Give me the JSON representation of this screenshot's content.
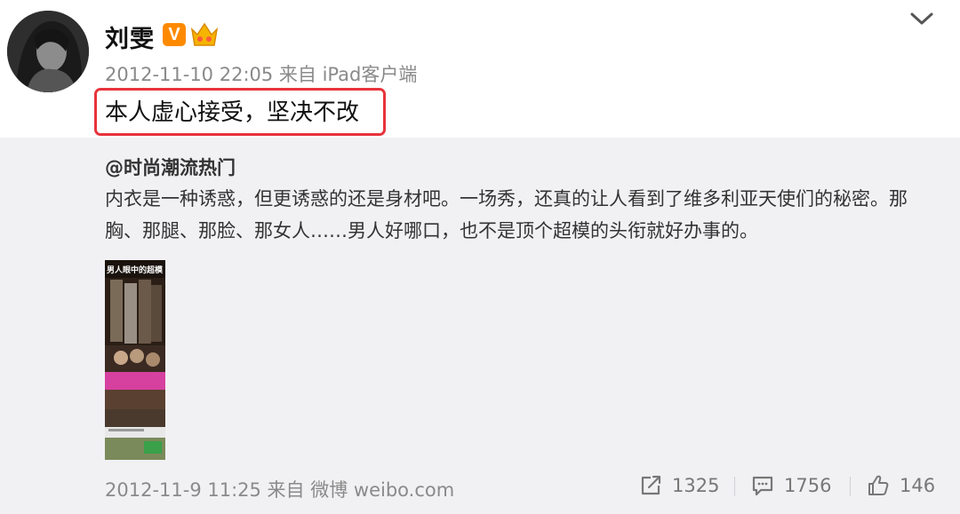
{
  "post": {
    "author": "刘雯",
    "verified_badge": "V",
    "meta": "2012-11-10 22:05 来自 iPad客户端",
    "text": "本人虚心接受，坚决不改"
  },
  "repost": {
    "author": "@时尚潮流热门",
    "text": "内衣是一种诱惑，但更诱惑的还是身材吧。一场秀，还真的让人看到了维多利亚天使们的秘密。那胸、那腿、那脸、那女人……男人好哪口，也不是顶个超模的头衔就好办事的。",
    "image_caption": "男人眼中的超模",
    "meta": "2012-11-9 11:25 来自 微博 weibo.com",
    "actions": {
      "repost_count": "1325",
      "comment_count": "1756",
      "like_count": "146"
    }
  },
  "icons": [
    "avatar",
    "verified-icon",
    "crown-icon",
    "chevron-down-icon",
    "share-icon",
    "comment-icon",
    "like-icon"
  ],
  "colors": {
    "highlight_border": "#e8343c",
    "verified": "#ff8a00",
    "repost_bg": "#f1f1f4",
    "meta_text": "#8a8a8a"
  }
}
